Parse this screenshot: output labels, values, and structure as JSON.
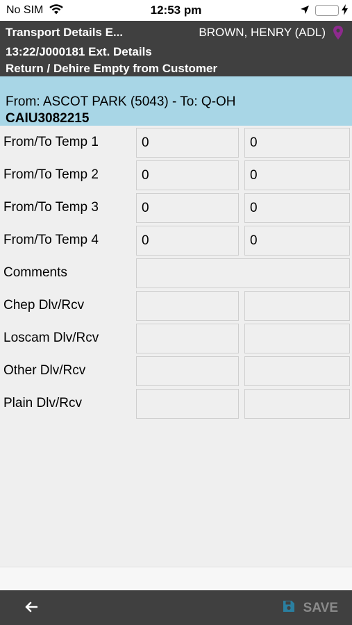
{
  "status_bar": {
    "carrier": "No SIM",
    "time": "12:53 pm"
  },
  "header": {
    "title": "Transport Details E...",
    "user": "BROWN, HENRY (ADL)",
    "subtitle1": "13:22/J000181 Ext. Details",
    "subtitle2": "Return / Dehire Empty from Customer"
  },
  "route": {
    "line1": "From: ASCOT PARK (5043) - To: Q-OH",
    "container": "CAIU3082215"
  },
  "form": {
    "temp1": {
      "label": "From/To Temp 1",
      "from": "0",
      "to": "0"
    },
    "temp2": {
      "label": "From/To Temp 2",
      "from": "0",
      "to": "0"
    },
    "temp3": {
      "label": "From/To Temp 3",
      "from": "0",
      "to": "0"
    },
    "temp4": {
      "label": "From/To Temp 4",
      "from": "0",
      "to": "0"
    },
    "comments": {
      "label": "Comments",
      "value": ""
    },
    "chep": {
      "label": "Chep Dlv/Rcv",
      "dlv": "",
      "rcv": ""
    },
    "loscam": {
      "label": "Loscam Dlv/Rcv",
      "dlv": "",
      "rcv": ""
    },
    "other": {
      "label": "Other Dlv/Rcv",
      "dlv": "",
      "rcv": ""
    },
    "plain": {
      "label": "Plain Dlv/Rcv",
      "dlv": "",
      "rcv": ""
    }
  },
  "toolbar": {
    "save_label": "SAVE"
  },
  "colors": {
    "header_bg": "#404040",
    "route_bg": "#a8d6e6",
    "battery": "#4cd964",
    "pin": "#8e2a8e"
  }
}
